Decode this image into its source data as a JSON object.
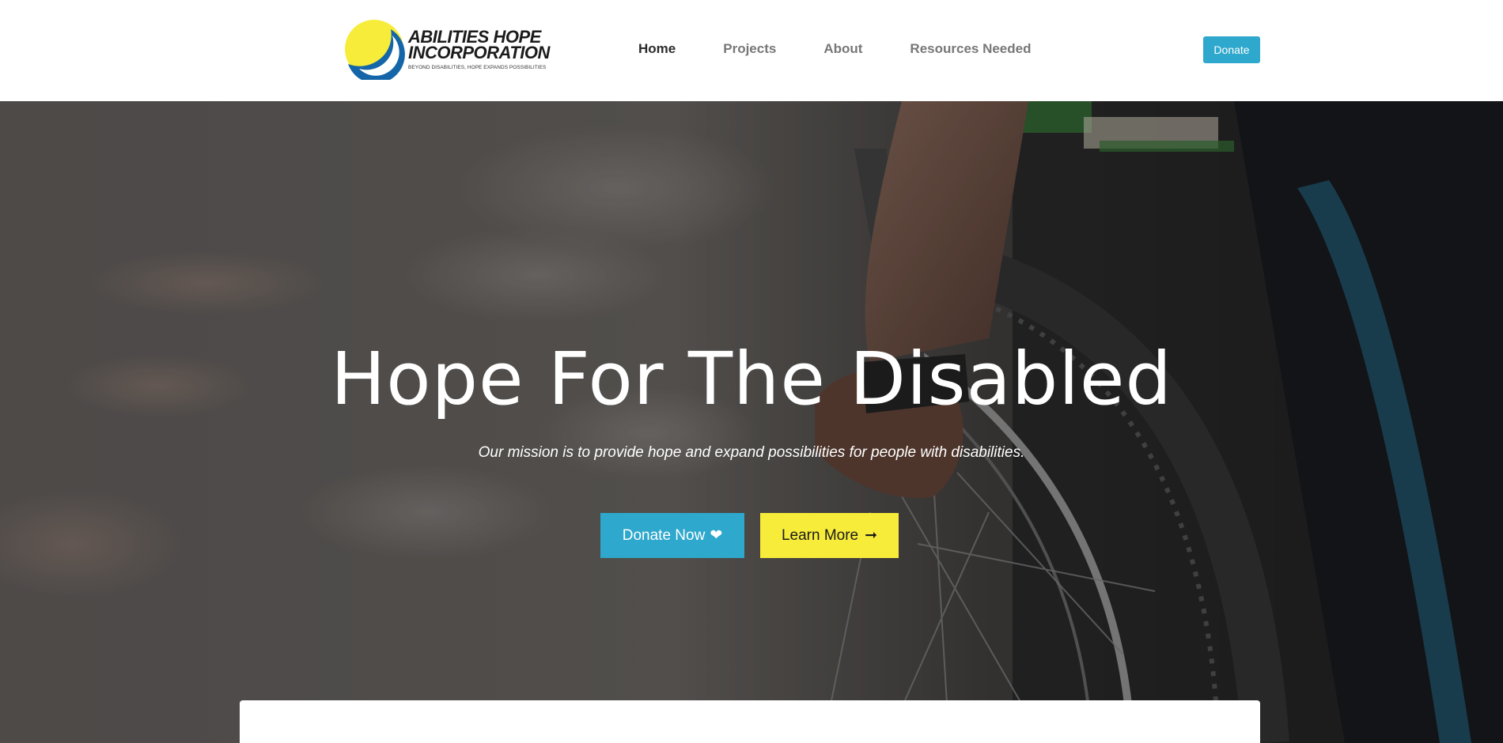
{
  "brand": {
    "name_line1": "ABILITIES HOPE",
    "name_line2": "INCORPORATION",
    "tagline": "BEYOND DISABILITIES, HOPE EXPANDS POSSIBILITIES",
    "logo_icon": "circle-swoosh-logo-icon",
    "colors": {
      "yellow": "#f7ec3a",
      "blue": "#1466a8"
    }
  },
  "nav": {
    "items": [
      {
        "label": "Home",
        "active": true
      },
      {
        "label": "Projects",
        "active": false
      },
      {
        "label": "About",
        "active": false
      },
      {
        "label": "Resources Needed",
        "active": false
      }
    ],
    "donate_label": "Donate"
  },
  "hero": {
    "title": "Hope For The Disabled",
    "subtitle": "Our mission is to provide hope and expand possibilities for people with disabilities.",
    "buttons": {
      "donate_now": {
        "label": "Donate Now",
        "icon": "heart-icon",
        "glyph": "❤"
      },
      "learn_more": {
        "label": "Learn More",
        "icon": "arrow-right-icon",
        "glyph": "➞"
      }
    },
    "background_image": "wheelchair-hand-on-wheel-photo"
  },
  "theme": {
    "accent": "#2ea8cc",
    "cta_secondary": "#f7ec3a",
    "nav_active": "#2b2b2b",
    "nav_inactive": "#777777"
  }
}
